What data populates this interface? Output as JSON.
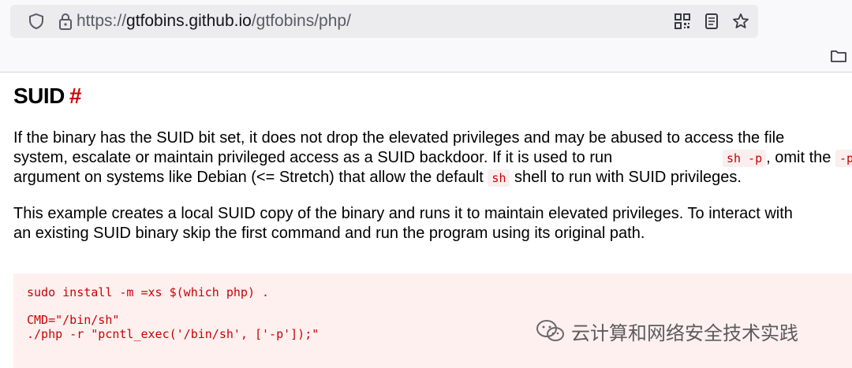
{
  "browser": {
    "url_scheme": "https://",
    "url_host": "gtfobins.github.io",
    "url_path": "/gtfobins/php/",
    "icons": [
      "shield-icon",
      "lock-icon",
      "qr-code-icon",
      "reader-view-icon",
      "bookmark-star-icon",
      "folder-icon"
    ]
  },
  "section": {
    "heading": "SUID",
    "anchor": "#",
    "p1": {
      "line1": "If the binary has the SUID bit set, it does not drop the elevated privileges and may be abused to access the file",
      "line2_a": "system, escalate or maintain privileged access as a SUID backdoor. If it is used to run",
      "code1": "sh -p",
      "line2_b": ", omit the",
      "code2": "-p",
      "line3_a": "argument on systems like Debian (<= Stretch) that allow the default",
      "code3": "sh",
      "line3_b": "shell to run with SUID privileges."
    },
    "p2": {
      "line1": "This example creates a local SUID copy of the binary and runs it to maintain elevated privileges. To interact with",
      "line2": "an existing SUID binary skip the first command and run the program using its original path."
    },
    "code_lines": [
      "sudo install -m =xs $(which php) .",
      "",
      "CMD=\"/bin/sh\"",
      "./php -r \"pcntl_exec('/bin/sh', ['-p']);\""
    ]
  },
  "watermark": {
    "text": "云计算和网络安全技术实践"
  },
  "colors": {
    "accent": "#cc0000",
    "code_bg": "#fff0f0",
    "toolbar_bg": "#f9f9fb",
    "urlbar_bg": "#ececef"
  }
}
